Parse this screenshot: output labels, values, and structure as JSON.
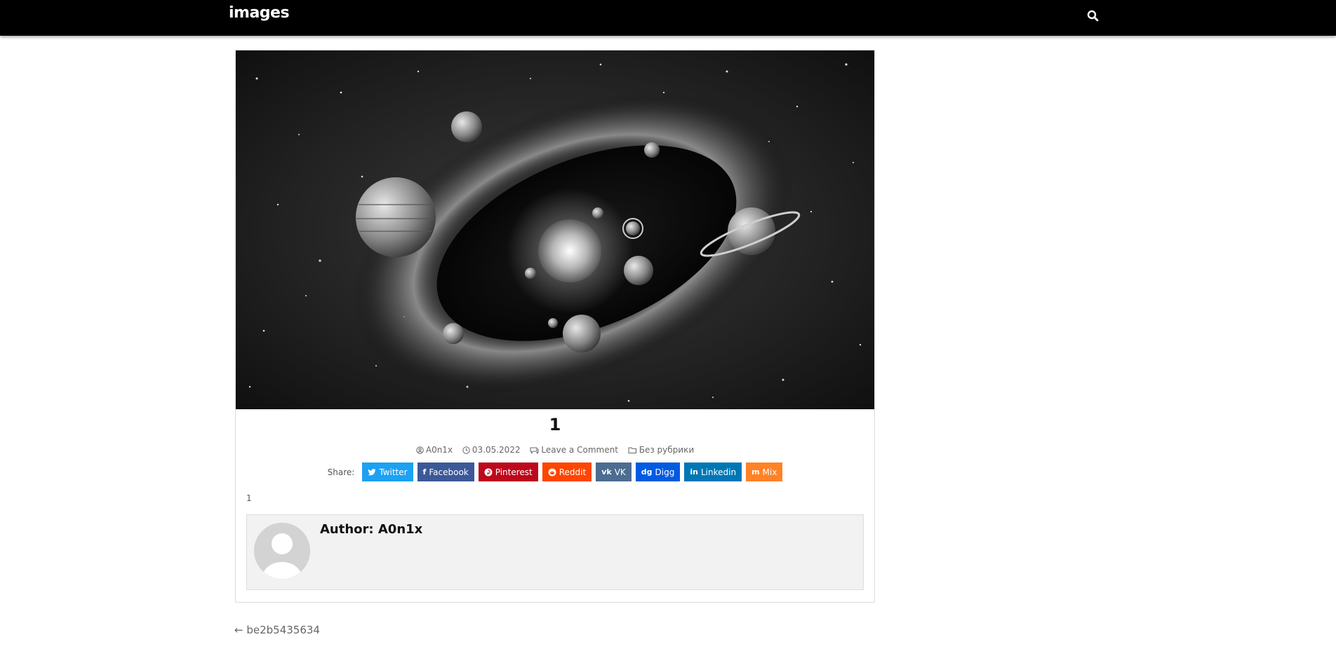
{
  "header": {
    "logo": "images"
  },
  "post": {
    "title": "1",
    "author": "A0n1x",
    "date": "03.05.2022",
    "comment_link": "Leave a Comment",
    "category": "Без рубрики",
    "body": "1"
  },
  "share": {
    "label": "Share:",
    "buttons": [
      {
        "label": "Twitter",
        "color": "#1da1f2",
        "icon": "twitter-icon"
      },
      {
        "label": "Facebook",
        "color": "#3b5998",
        "icon": "facebook-icon"
      },
      {
        "label": "Pinterest",
        "color": "#bd081c",
        "icon": "pinterest-icon"
      },
      {
        "label": "Reddit",
        "color": "#ff4500",
        "icon": "reddit-icon"
      },
      {
        "label": "VK",
        "color": "#4c6c91",
        "icon": "vk-icon"
      },
      {
        "label": "Digg",
        "color": "#005be2",
        "icon": "digg-icon"
      },
      {
        "label": "Linkedin",
        "color": "#0077b5",
        "icon": "linkedin-icon"
      },
      {
        "label": "Mix",
        "color": "#ff8226",
        "icon": "mix-icon"
      }
    ]
  },
  "author_box": {
    "name": "Author: A0n1x"
  },
  "navigation": {
    "prev": "← be2b5435634"
  }
}
